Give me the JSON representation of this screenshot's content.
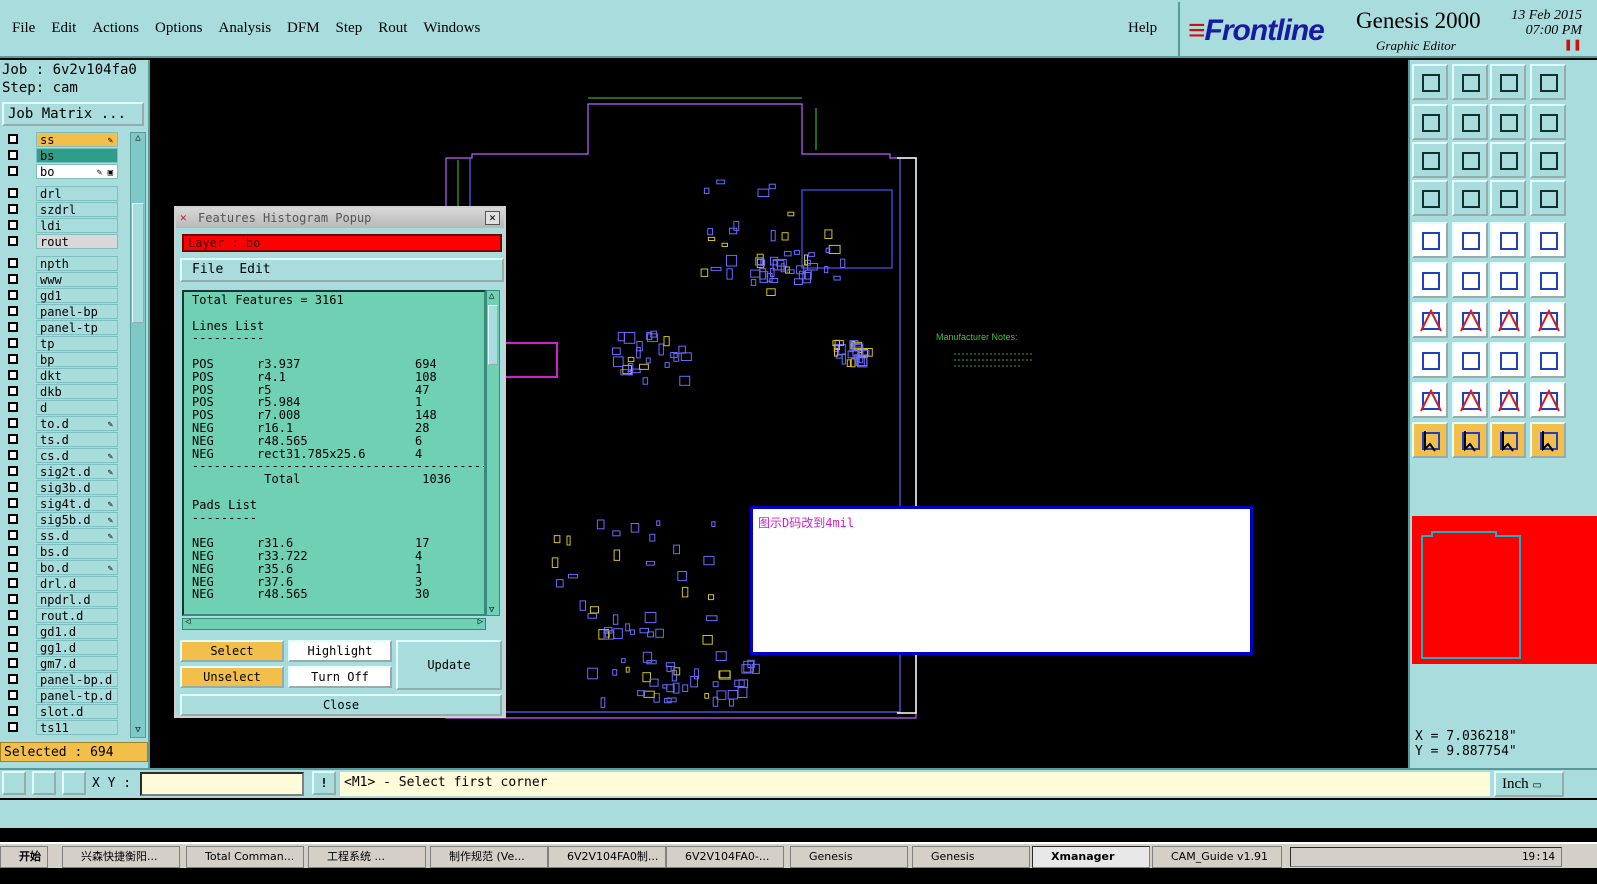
{
  "menubar": {
    "items": [
      "File",
      "Edit",
      "Actions",
      "Options",
      "Analysis",
      "DFM",
      "Step",
      "Rout",
      "Windows"
    ],
    "help": "Help"
  },
  "brand": {
    "logo": "Frontline",
    "product": "Genesis 2000",
    "subtitle": "Graphic Editor",
    "date": "13 Feb 2015",
    "time": "07:00 PM"
  },
  "job": {
    "job_label": "Job : 6v2v104fa0",
    "step_label": "Step: cam",
    "job_matrix_button": "Job Matrix ..."
  },
  "layers": [
    {
      "name": "ss",
      "color": "#f2c04a",
      "mark": "✎"
    },
    {
      "name": "bs",
      "color": "#2e9e8a",
      "mark": ""
    },
    {
      "name": "bo",
      "color": "#ffffff",
      "mark": "✎ ▣"
    },
    {
      "name": "drl",
      "color": "#a9dcdc",
      "mark": ""
    },
    {
      "name": "szdrl",
      "color": "#a9dcdc",
      "mark": ""
    },
    {
      "name": "ldi",
      "color": "#a9dcdc",
      "mark": ""
    },
    {
      "name": "rout",
      "color": "#d8d8d8",
      "mark": ""
    },
    {
      "name": "npth",
      "color": "#a9dcdc",
      "mark": ""
    },
    {
      "name": "www",
      "color": "#a9dcdc",
      "mark": ""
    },
    {
      "name": "gd1",
      "color": "#a9dcdc",
      "mark": ""
    },
    {
      "name": "panel-bp",
      "color": "#a9dcdc",
      "mark": ""
    },
    {
      "name": "panel-tp",
      "color": "#a9dcdc",
      "mark": ""
    },
    {
      "name": "tp",
      "color": "#a9dcdc",
      "mark": ""
    },
    {
      "name": "bp",
      "color": "#a9dcdc",
      "mark": ""
    },
    {
      "name": "dkt",
      "color": "#a9dcdc",
      "mark": ""
    },
    {
      "name": "dkb",
      "color": "#a9dcdc",
      "mark": ""
    },
    {
      "name": "d",
      "color": "#a9dcdc",
      "mark": ""
    },
    {
      "name": "to.d",
      "color": "#a9dcdc",
      "mark": "✎"
    },
    {
      "name": "ts.d",
      "color": "#a9dcdc",
      "mark": ""
    },
    {
      "name": "cs.d",
      "color": "#a9dcdc",
      "mark": "✎"
    },
    {
      "name": "sig2t.d",
      "color": "#a9dcdc",
      "mark": "✎"
    },
    {
      "name": "sig3b.d",
      "color": "#a9dcdc",
      "mark": ""
    },
    {
      "name": "sig4t.d",
      "color": "#a9dcdc",
      "mark": "✎"
    },
    {
      "name": "sig5b.d",
      "color": "#a9dcdc",
      "mark": "✎"
    },
    {
      "name": "ss.d",
      "color": "#a9dcdc",
      "mark": "✎"
    },
    {
      "name": "bs.d",
      "color": "#a9dcdc",
      "mark": ""
    },
    {
      "name": "bo.d",
      "color": "#a9dcdc",
      "mark": "✎"
    },
    {
      "name": "drl.d",
      "color": "#a9dcdc",
      "mark": ""
    },
    {
      "name": "npdrl.d",
      "color": "#a9dcdc",
      "mark": ""
    },
    {
      "name": "rout.d",
      "color": "#a9dcdc",
      "mark": ""
    },
    {
      "name": "gd1.d",
      "color": "#a9dcdc",
      "mark": ""
    },
    {
      "name": "gg1.d",
      "color": "#a9dcdc",
      "mark": ""
    },
    {
      "name": "gm7.d",
      "color": "#a9dcdc",
      "mark": ""
    },
    {
      "name": "panel-bp.d",
      "color": "#a9dcdc",
      "mark": ""
    },
    {
      "name": "panel-tp.d",
      "color": "#a9dcdc",
      "mark": ""
    },
    {
      "name": "slot.d",
      "color": "#a9dcdc",
      "mark": ""
    },
    {
      "name": "ts11",
      "color": "#a9dcdc",
      "mark": ""
    }
  ],
  "selected_label": "Selected : 694",
  "popup": {
    "title": "Features Histogram Popup",
    "layer_label": "Layer :  bo",
    "menu": [
      "File",
      "Edit"
    ],
    "total_features": "Total Features = 3161",
    "lines_header": "Lines List",
    "lines": [
      {
        "pol": "POS",
        "sym": "r3.937",
        "count": "694"
      },
      {
        "pol": "POS",
        "sym": "r4.1",
        "count": "108"
      },
      {
        "pol": "POS",
        "sym": "r5",
        "count": "47"
      },
      {
        "pol": "POS",
        "sym": "r5.984",
        "count": "1"
      },
      {
        "pol": "POS",
        "sym": "r7.008",
        "count": "148"
      },
      {
        "pol": "NEG",
        "sym": "r16.1",
        "count": "28"
      },
      {
        "pol": "NEG",
        "sym": "r48.565",
        "count": "6"
      },
      {
        "pol": "NEG",
        "sym": "rect31.785x25.6",
        "count": "4"
      }
    ],
    "lines_total_label": "Total",
    "lines_total": "1036",
    "pads_header": "Pads List",
    "pads": [
      {
        "pol": "NEG",
        "sym": "r31.6",
        "count": "17"
      },
      {
        "pol": "NEG",
        "sym": "r33.722",
        "count": "4"
      },
      {
        "pol": "NEG",
        "sym": "r35.6",
        "count": "1"
      },
      {
        "pol": "NEG",
        "sym": "r37.6",
        "count": "3"
      },
      {
        "pol": "NEG",
        "sym": "r48.565",
        "count": "30"
      }
    ],
    "buttons": {
      "select": "Select",
      "highlight": "Highlight",
      "update": "Update",
      "unselect": "Unselect",
      "turn_off": "Turn Off",
      "close": "Close"
    }
  },
  "note": {
    "text": "图示D码改到4mil"
  },
  "manufacturer_notes": "Manufacturer Notes:",
  "coords": {
    "x": "X = 7.036218\"",
    "y": "Y = 9.887754\""
  },
  "cmdbar": {
    "xy_label": "X Y :",
    "prompt": "<M1> - Select first corner",
    "units": "Inch"
  },
  "taskbar": {
    "start": "开始",
    "tasks": [
      "兴森快捷衡阳...",
      "Total Comman...",
      "工程系统    ...",
      "制作规范 (Ve...",
      "6V2V104FA0制...",
      "6V2V104FA0-...",
      "Genesis",
      "Genesis",
      "Xmanager",
      "CAM_Guide v1.91"
    ],
    "clock": "19:14"
  },
  "colors": {
    "panel": "#a9dcdc",
    "accent": "#f2c04a",
    "board_outline": "#c060ff",
    "component": "#6a6aff",
    "highlight": "#d020d0"
  }
}
